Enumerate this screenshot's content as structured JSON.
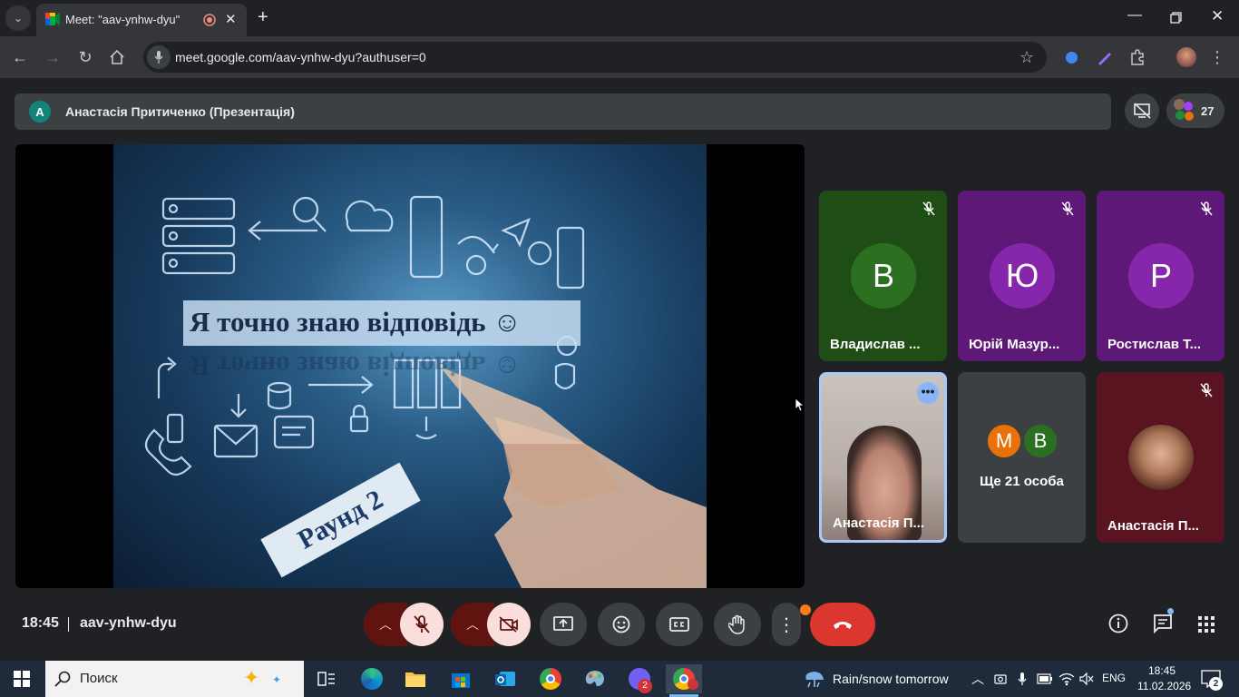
{
  "browser": {
    "tab_title": "Meet: \"aav-ynhw-dyu\"",
    "url": "meet.google.com/aav-ynhw-dyu?authuser=0"
  },
  "meet": {
    "presenter": {
      "avatar_letter": "A",
      "label": "Анастасія Притиченко (Презентація)"
    },
    "participant_count": "27",
    "slide": {
      "title": "Я точно знаю відповідь ☺",
      "round_label": "Раунд 2"
    },
    "tiles": [
      {
        "letter": "В",
        "name": "Владислав ...",
        "bg": "#1e4e16",
        "avatar_color": "#2b6f21",
        "muted": true
      },
      {
        "letter": "Ю",
        "name": "Юрій Мазур...",
        "bg": "#5e1878",
        "avatar_color": "#8526ab",
        "muted": true
      },
      {
        "letter": "Р",
        "name": "Ростислав Т...",
        "bg": "#5e1878",
        "avatar_color": "#8526ab",
        "muted": true
      },
      {
        "name": "Анастасія П...",
        "has_video": true,
        "active": true
      },
      {
        "name": "Ще 21 особа",
        "letters": [
          "М",
          "В"
        ],
        "letter_colors": [
          "#e8710a",
          "#2b6f21"
        ]
      },
      {
        "name": "Анастасія П...",
        "bg": "#5a1420",
        "muted": true,
        "photo": true
      }
    ],
    "time": "18:45",
    "meeting_code": "aav-ynhw-dyu"
  },
  "taskbar": {
    "search_placeholder": "Поиск",
    "weather": "Rain/snow tomorrow",
    "lang": "ENG",
    "time": "18:45",
    "date": "11.02.2026",
    "viber_badge": "2",
    "notification_count": "2"
  }
}
